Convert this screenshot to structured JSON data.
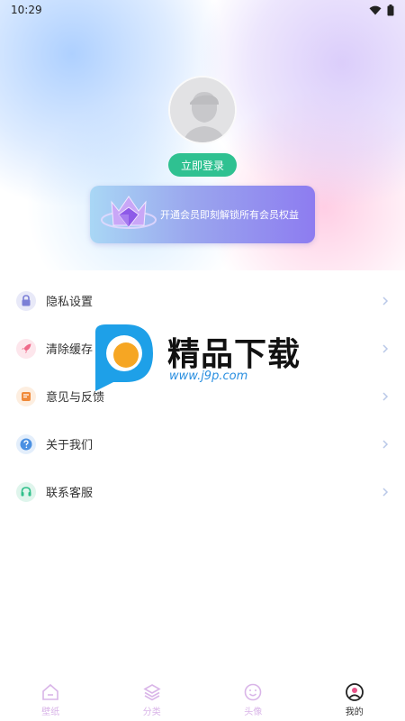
{
  "status_bar": {
    "time": "10:29"
  },
  "profile": {
    "login_label": "立即登录"
  },
  "vip_banner": {
    "text": "开通会员即刻解锁所有会员权益"
  },
  "menu": {
    "items": [
      {
        "label": "隐私设置",
        "icon": "lock-icon",
        "color": "#7b7fd6"
      },
      {
        "label": "清除缓存",
        "icon": "rocket-icon",
        "color": "#ef6a8a"
      },
      {
        "label": "意见与反馈",
        "icon": "feedback-icon",
        "color": "#f08a3a"
      },
      {
        "label": "关于我们",
        "icon": "question-icon",
        "color": "#4a90e2"
      },
      {
        "label": "联系客服",
        "icon": "headset-icon",
        "color": "#2fbf8a"
      }
    ]
  },
  "watermark": {
    "title": "精品下载",
    "url": "www.j9p.com"
  },
  "tabbar": {
    "items": [
      {
        "label": "壁纸",
        "icon": "home-icon",
        "active": false
      },
      {
        "label": "分类",
        "icon": "layers-icon",
        "active": false
      },
      {
        "label": "头像",
        "icon": "smile-icon",
        "active": false
      },
      {
        "label": "我的",
        "icon": "profile-icon",
        "active": true
      }
    ]
  },
  "colors": {
    "accent": "#2fc191",
    "tab_inactive": "#d9b5e8",
    "vip_start": "#a9d7f5",
    "vip_end": "#8d7cf0"
  }
}
